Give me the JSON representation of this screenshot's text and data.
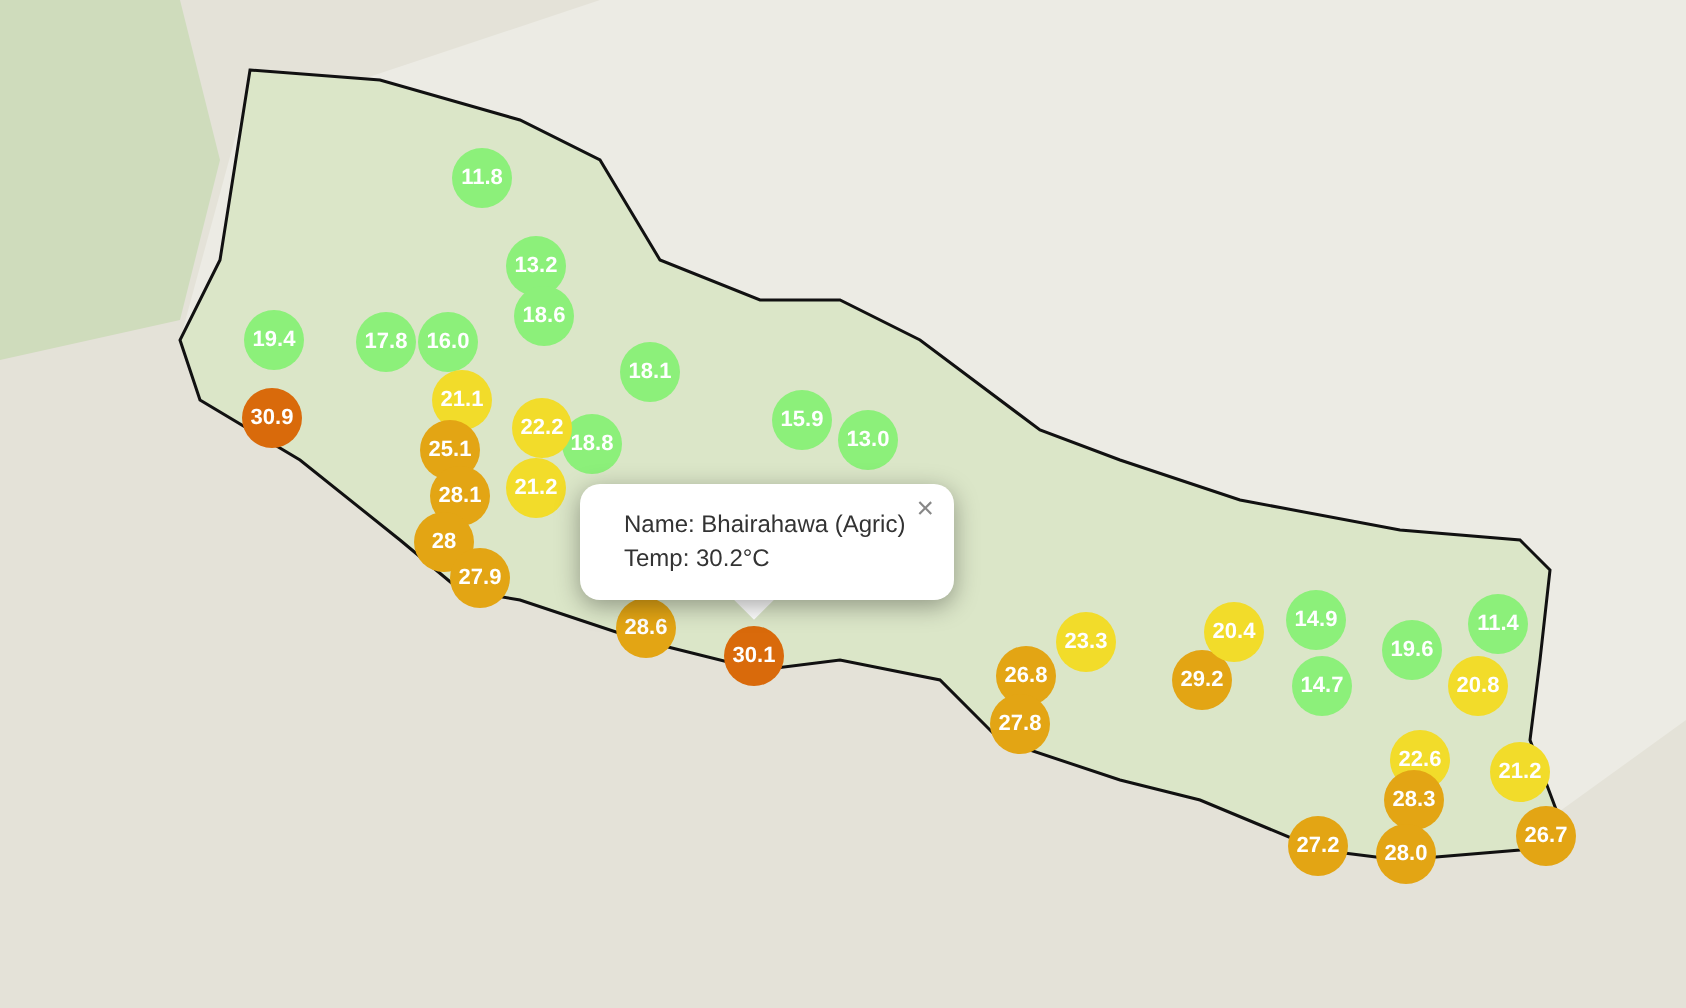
{
  "markers": [
    {
      "value": "11.8",
      "color": "#8cf07a"
    },
    {
      "value": "13.2",
      "color": "#8cf07a"
    },
    {
      "value": "18.6",
      "color": "#8cf07a"
    },
    {
      "value": "19.4",
      "color": "#8cf07a"
    },
    {
      "value": "17.8",
      "color": "#8cf07a"
    },
    {
      "value": "16.0",
      "color": "#8cf07a"
    },
    {
      "value": "18.1",
      "color": "#8cf07a"
    },
    {
      "value": "18.8",
      "color": "#8cf07a"
    },
    {
      "value": "15.9",
      "color": "#8cf07a"
    },
    {
      "value": "13.0",
      "color": "#8cf07a"
    },
    {
      "value": "30.9",
      "color": "#d96a0b"
    },
    {
      "value": "21.1",
      "color": "#f2dc2a"
    },
    {
      "value": "22.2",
      "color": "#f2dc2a"
    },
    {
      "value": "21.2",
      "color": "#f2dc2a"
    },
    {
      "value": "25.1",
      "color": "#e3a514"
    },
    {
      "value": "28.1",
      "color": "#e3a514"
    },
    {
      "value": "28",
      "color": "#e3a514"
    },
    {
      "value": "27.9",
      "color": "#e3a514"
    },
    {
      "value": "28.6",
      "color": "#e3a514"
    },
    {
      "value": "30.1",
      "color": "#d96a0b"
    },
    {
      "value": "23.3",
      "color": "#f2dc2a"
    },
    {
      "value": "26.8",
      "color": "#e3a514"
    },
    {
      "value": "27.8",
      "color": "#e3a514"
    },
    {
      "value": "29.2",
      "color": "#e3a514"
    },
    {
      "value": "20.4",
      "color": "#f2dc2a"
    },
    {
      "value": "14.9",
      "color": "#8cf07a"
    },
    {
      "value": "14.7",
      "color": "#8cf07a"
    },
    {
      "value": "19.6",
      "color": "#8cf07a"
    },
    {
      "value": "11.4",
      "color": "#8cf07a"
    },
    {
      "value": "20.8",
      "color": "#f2dc2a"
    },
    {
      "value": "22.6",
      "color": "#f2dc2a"
    },
    {
      "value": "21.2",
      "color": "#f2dc2a"
    },
    {
      "value": "28.3",
      "color": "#e3a514"
    },
    {
      "value": "27.2",
      "color": "#e3a514"
    },
    {
      "value": "28.0",
      "color": "#e3a514"
    },
    {
      "value": "26.7",
      "color": "#e3a514"
    }
  ],
  "popup": {
    "name_line": "Name: Bhairahawa (Agric)",
    "temp_line": "Temp: 30.2°C",
    "close": "×"
  }
}
